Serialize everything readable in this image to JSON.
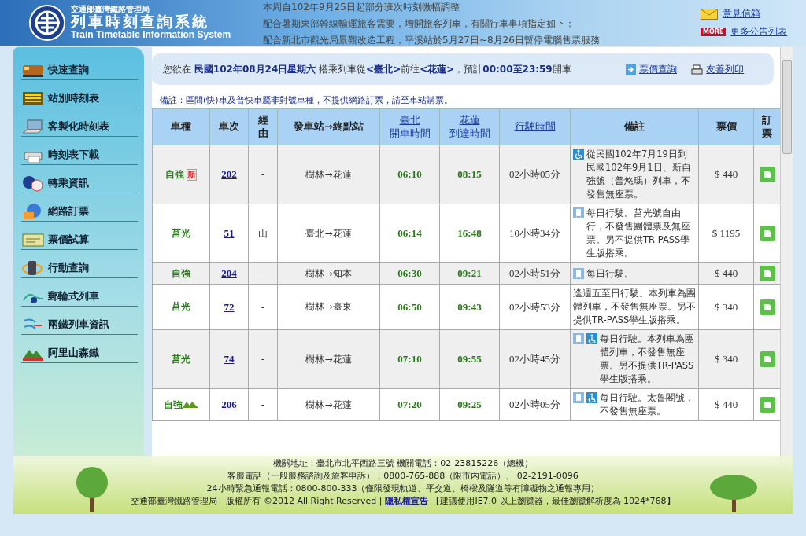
{
  "header": {
    "agency": "交通部臺灣鐵路管理局",
    "title": "列車時刻查詢系統",
    "subtitle": "Train Timetable Information System",
    "announcements": [
      "本周自102年9月25日起部分班次時刻微幅調整",
      "配合暑期東部幹線輸運旅客需要，增開旅客列車，有關行車事項指定如下：",
      "配合新北市觀光局景觀改造工程，平溪站於5月27日~8月26日暫停電腦售票服務"
    ],
    "mailbox": "意見信箱",
    "more_badge": "MORE",
    "more_link": "更多公告列表"
  },
  "sidebar": {
    "items": [
      {
        "label": "快速查詢"
      },
      {
        "label": "站別時刻表"
      },
      {
        "label": "客製化時刻表"
      },
      {
        "label": "時刻表下載"
      },
      {
        "label": "轉乘資訊"
      },
      {
        "label": "網路訂票"
      },
      {
        "label": "票價試算"
      },
      {
        "label": "行動查詢"
      },
      {
        "label": "郵輪式列車"
      },
      {
        "label": "兩鐵列車資訊"
      },
      {
        "label": "阿里山森鐵"
      }
    ]
  },
  "query": {
    "summary": "您欲在 **民國102年08月24日星期六** 搭乘列車從**<臺北>**前往**<花蓮>**，預計**00:00至23:59**開車",
    "fare_link": "票價查詢",
    "print_link": "友善列印"
  },
  "note": "備註：區間(快)車及普快車屬非對號車種，不提供網路訂票，請至車站購票。",
  "table": {
    "columns": [
      {
        "lines": [
          "車種"
        ],
        "link": false
      },
      {
        "lines": [
          "車次"
        ],
        "link": false
      },
      {
        "lines": [
          "經",
          "由"
        ],
        "link": false
      },
      {
        "lines": [
          "發車站→終點站"
        ],
        "link": false
      },
      {
        "lines": [
          "臺北",
          "開車時間"
        ],
        "link": true
      },
      {
        "lines": [
          "花蓮",
          "到達時間"
        ],
        "link": true
      },
      {
        "lines": [
          "行駛時間"
        ],
        "link": true
      },
      {
        "lines": [
          "備註"
        ],
        "link": false
      },
      {
        "lines": [
          "票價"
        ],
        "link": false
      },
      {
        "lines": [
          "訂",
          "票"
        ],
        "link": false
      }
    ],
    "rows": [
      {
        "type": "自強",
        "badge": {
          "kind": "new",
          "text": "新"
        },
        "number": "202",
        "via": "-",
        "route": "樹林→花蓮",
        "depart": "06:10",
        "arrive": "08:15",
        "duration": "02小時05分",
        "remark_icons": [
          {
            "kind": "wheelchair"
          }
        ],
        "remark": "從民國102年7月19日到民國102年9月1日、新自強號（普悠瑪）列車，不發售無座票。",
        "price": "$ 440"
      },
      {
        "type": "莒光",
        "number": "51",
        "via": "山",
        "route": "臺北→花蓮",
        "depart": "06:14",
        "arrive": "16:48",
        "duration": "10小時34分",
        "remark_icons": [
          {
            "kind": "car"
          }
        ],
        "remark": "每日行駛。莒光號自由行，不發售團體票及無座票。另不提供TR-PASS學生版搭乘。",
        "price": "$ 1195"
      },
      {
        "type": "自強",
        "number": "204",
        "via": "-",
        "route": "樹林→知本",
        "depart": "06:30",
        "arrive": "09:21",
        "duration": "02小時51分",
        "remark_icons": [
          {
            "kind": "car"
          }
        ],
        "remark": "每日行駛。",
        "price": "$ 440"
      },
      {
        "type": "莒光",
        "number": "72",
        "via": "-",
        "route": "樹林→臺東",
        "depart": "06:50",
        "arrive": "09:43",
        "duration": "02小時53分",
        "remark_icons": [],
        "remark": "逢週五至日行駛。本列車為團體列車，不發售無座票。另不提供TR-PASS學生版搭乘。",
        "price": "$ 340"
      },
      {
        "type": "莒光",
        "number": "74",
        "via": "-",
        "route": "樹林→花蓮",
        "depart": "07:10",
        "arrive": "09:55",
        "duration": "02小時45分",
        "remark_icons": [
          {
            "kind": "car"
          },
          {
            "kind": "wheelchair"
          }
        ],
        "remark": "每日行駛。本列車為團體列車，不發售無座票。另不提供TR-PASS學生版搭乘。",
        "price": "$ 340"
      },
      {
        "type": "自強",
        "badge": {
          "kind": "mountain"
        },
        "number": "206",
        "via": "-",
        "route": "樹林→花蓮",
        "depart": "07:20",
        "arrive": "09:25",
        "duration": "02小時05分",
        "remark_icons": [
          {
            "kind": "car"
          },
          {
            "kind": "wheelchair"
          }
        ],
        "remark": "每日行駛。太魯閣號，不發售無座票。",
        "price": "$ 440"
      }
    ]
  },
  "footer": {
    "lines": [
      "機關地址：臺北市北平西路三號  機關電話：02-23815226（總機）",
      "客服電話（一般服務諮詢及旅客申訴）：0800-765-888（限市內電話）、 02-2191-0096",
      "24小時緊急通報電話：0800-800-333（僅限發現軌道、平交道、橋樑及隧道等有障礙物之通報專用）"
    ],
    "copyright": "交通部臺灣鐵路管理局　版權所有 ©2012 All Right Reserved |",
    "privacy_link": "隱私權宣告",
    "advice": "【建議使用IE7.0 以上瀏覽器，最佳瀏覽解析度為 1024*768】"
  }
}
